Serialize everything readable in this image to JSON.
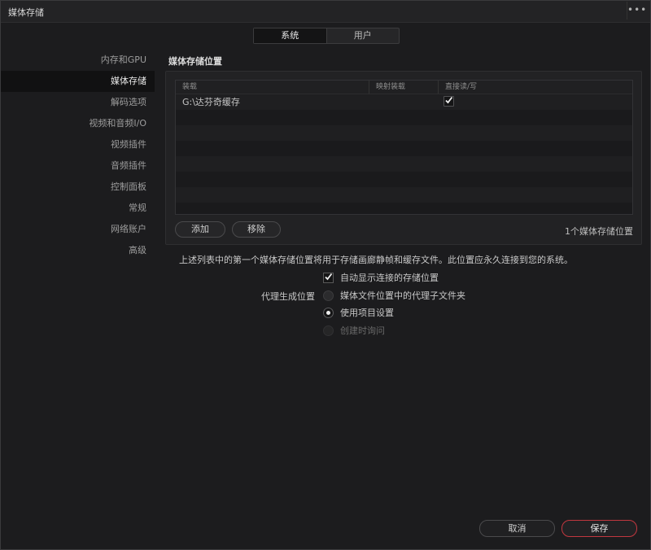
{
  "window": {
    "title": "媒体存储",
    "menu_label": "•••"
  },
  "tabs": [
    {
      "label": "系统",
      "active": true
    },
    {
      "label": "用户",
      "active": false
    }
  ],
  "sidebar": {
    "items": [
      {
        "label": "内存和GPU",
        "active": false
      },
      {
        "label": "媒体存储",
        "active": true
      },
      {
        "label": "解码选项",
        "active": false
      },
      {
        "label": "视频和音频I/O",
        "active": false
      },
      {
        "label": "视频插件",
        "active": false
      },
      {
        "label": "音频插件",
        "active": false
      },
      {
        "label": "控制面板",
        "active": false
      },
      {
        "label": "常规",
        "active": false
      },
      {
        "label": "网络账户",
        "active": false
      },
      {
        "label": "高级",
        "active": false
      }
    ]
  },
  "storage": {
    "section_title": "媒体存储位置",
    "columns": [
      "装载",
      "映射装载",
      "直接读/写"
    ],
    "rows": [
      {
        "mount": "G:\\达芬奇缓存",
        "mapped": "",
        "direct_rw": true
      }
    ],
    "add_label": "添加",
    "remove_label": "移除",
    "count_label": "1个媒体存储位置"
  },
  "note": "上述列表中的第一个媒体存储位置将用于存储画廊静帧和缓存文件。此位置应永久连接到您的系统。",
  "options": {
    "auto_show_label": "自动显示连接的存储位置",
    "auto_show_checked": true,
    "proxy_label": "代理生成位置",
    "proxy_choices": [
      {
        "label": "媒体文件位置中的代理子文件夹",
        "selected": false,
        "disabled": false
      },
      {
        "label": "使用项目设置",
        "selected": true,
        "disabled": false
      },
      {
        "label": "创建时询问",
        "selected": false,
        "disabled": true
      }
    ]
  },
  "footer": {
    "cancel_label": "取消",
    "save_label": "保存"
  },
  "colors": {
    "accent_save": "#c2373f",
    "background": "#1c1c1e"
  }
}
